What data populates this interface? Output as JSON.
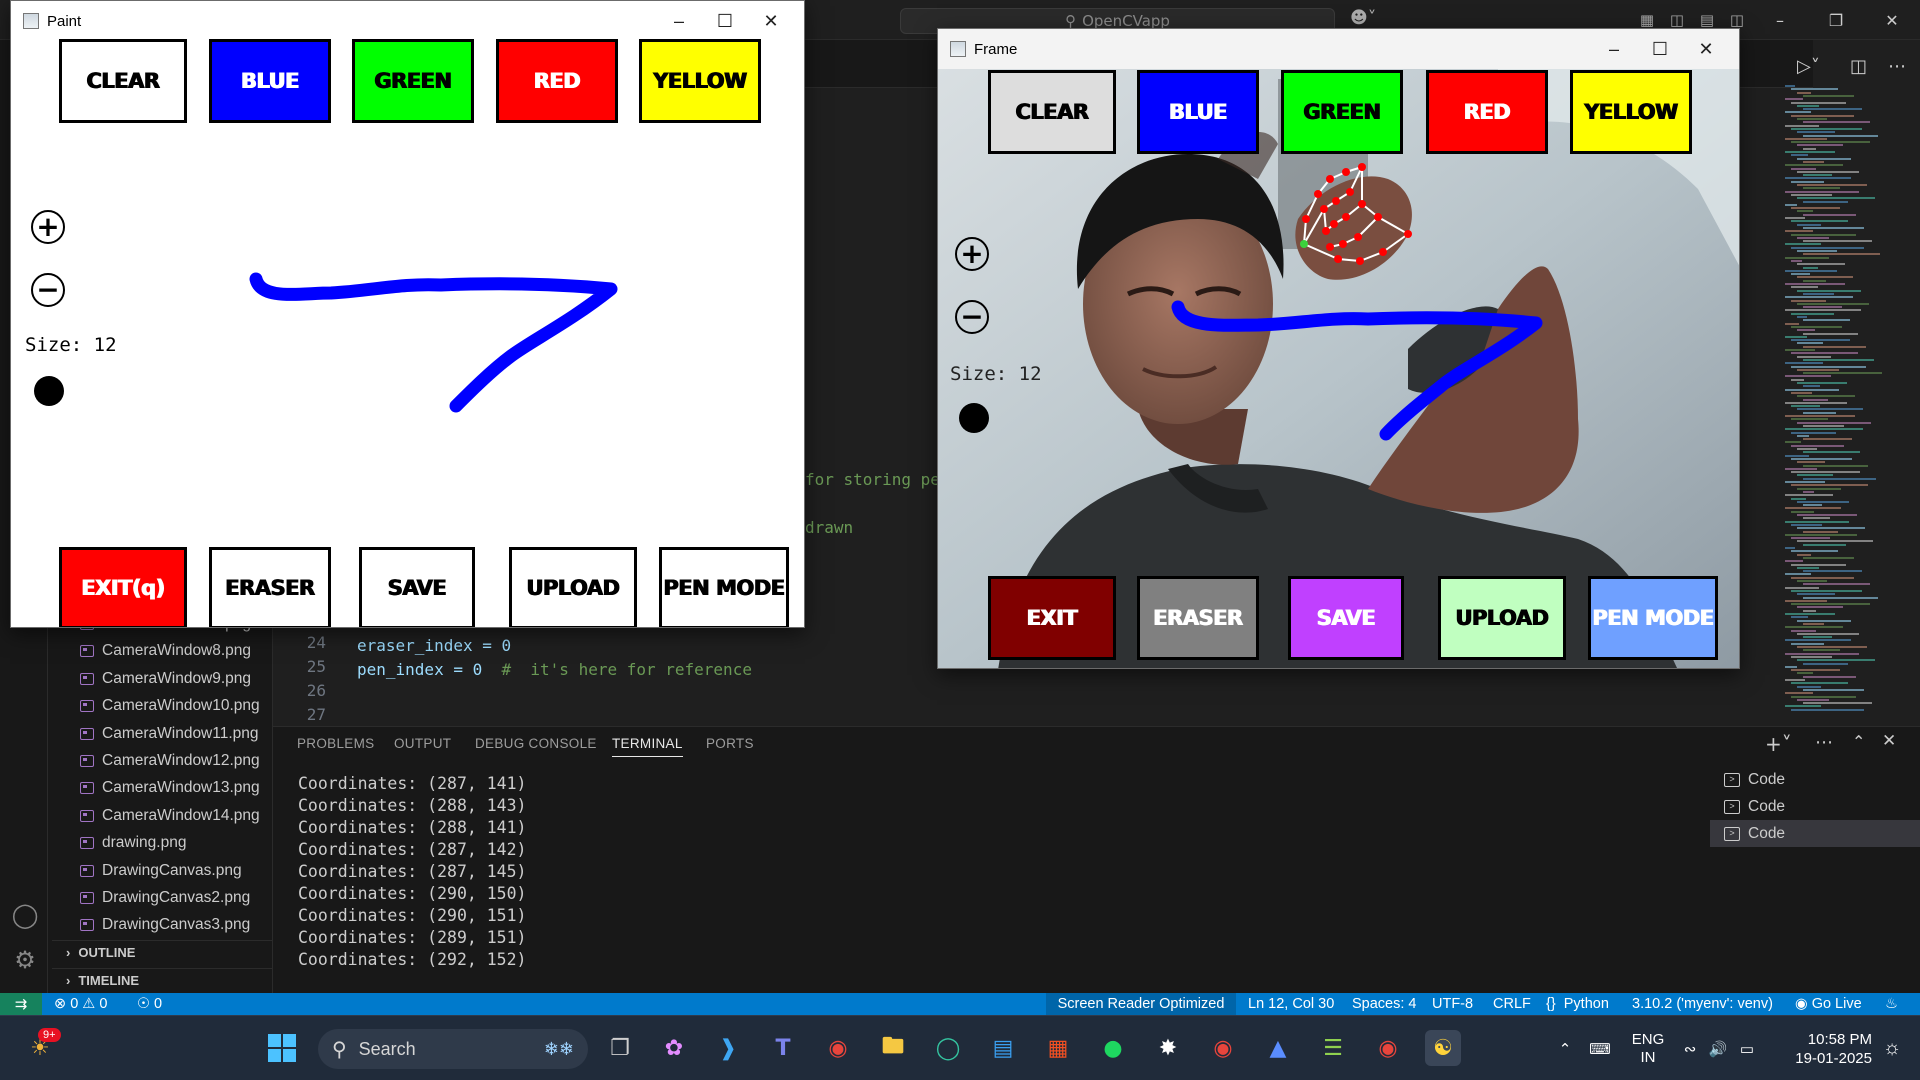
{
  "vscode": {
    "search_text": "OpenCVapp",
    "explorer_files": [
      "CameraWindow7.png",
      "CameraWindow8.png",
      "CameraWindow9.png",
      "CameraWindow10.png",
      "CameraWindow11.png",
      "CameraWindow12.png",
      "CameraWindow13.png",
      "CameraWindow14.png",
      "drawing.png",
      "DrawingCanvas.png",
      "DrawingCanvas2.png",
      "DrawingCanvas3.png"
    ],
    "outline_label": "OUTLINE",
    "timeline_label": "TIMELINE",
    "code": {
      "frag1": "for storing pe",
      "frag2": "drawn",
      "line24_num": "24",
      "line24": "eraser_index = 0",
      "line25_num": "25",
      "line25_code": "pen_index = 0",
      "line25_comment": "#  it's here for reference",
      "line26_num": "26",
      "line27_num": "27"
    },
    "panel_tabs": [
      "PROBLEMS",
      "OUTPUT",
      "DEBUG CONSOLE",
      "TERMINAL",
      "PORTS"
    ],
    "terminal_lines": [
      "Coordinates: (287, 141)",
      "Coordinates: (288, 143)",
      "Coordinates: (288, 141)",
      "Coordinates: (287, 142)",
      "Coordinates: (287, 145)",
      "Coordinates: (290, 150)",
      "Coordinates: (290, 151)",
      "Coordinates: (289, 151)",
      "Coordinates: (292, 152)"
    ],
    "terminal_instances": [
      "Code",
      "Code",
      "Code"
    ],
    "status": {
      "errors": "0",
      "warnings": "0",
      "ports": "0",
      "screen_reader": "Screen Reader Optimized",
      "position": "Ln 12, Col 30",
      "spaces": "Spaces: 4",
      "encoding": "UTF-8",
      "eol": "CRLF",
      "language": "Python",
      "interpreter": "3.10.2 ('myenv': venv)",
      "golive": "Go Live"
    }
  },
  "paint_window": {
    "title": "Paint",
    "top_buttons": [
      {
        "label": "CLEAR",
        "bg": "#ffffff",
        "fg": "#000000"
      },
      {
        "label": "BLUE",
        "bg": "#0000ff",
        "fg": "#ffffff"
      },
      {
        "label": "GREEN",
        "bg": "#00ff00",
        "fg": "#000000"
      },
      {
        "label": "RED",
        "bg": "#ff0000",
        "fg": "#ffffff"
      },
      {
        "label": "YELLOW",
        "bg": "#ffff00",
        "fg": "#000000"
      }
    ],
    "bottom_buttons": [
      {
        "label": "EXIT(q)",
        "bg": "#ff0000",
        "fg": "#ffffff"
      },
      {
        "label": "ERASER",
        "bg": "#ffffff",
        "fg": "#000000"
      },
      {
        "label": "SAVE",
        "bg": "#ffffff",
        "fg": "#000000"
      },
      {
        "label": "UPLOAD",
        "bg": "#ffffff",
        "fg": "#000000"
      },
      {
        "label": "PEN MODE",
        "bg": "#ffffff",
        "fg": "#000000"
      }
    ],
    "zoom_in": "+",
    "zoom_out": "−",
    "size_label": "Size:",
    "size_value": "12",
    "stroke_color": "#0000ff"
  },
  "frame_window": {
    "title": "Frame",
    "top_buttons": [
      {
        "label": "CLEAR",
        "bg": "#dddddd",
        "fg": "#000000"
      },
      {
        "label": "BLUE",
        "bg": "#0000ff",
        "fg": "#ffffff"
      },
      {
        "label": "GREEN",
        "bg": "#00ff00",
        "fg": "#000000"
      },
      {
        "label": "RED",
        "bg": "#ff0000",
        "fg": "#ffffff"
      },
      {
        "label": "YELLOW",
        "bg": "#ffff00",
        "fg": "#000000"
      }
    ],
    "bottom_buttons": [
      {
        "label": "EXIT",
        "bg": "#800000",
        "fg": "#ffffff"
      },
      {
        "label": "ERASER",
        "bg": "#808080",
        "fg": "#ffffff"
      },
      {
        "label": "SAVE",
        "bg": "#c040ff",
        "fg": "#ffffff"
      },
      {
        "label": "UPLOAD",
        "bg": "#c0ffc0",
        "fg": "#000000"
      },
      {
        "label": "PEN MODE",
        "bg": "#6fa0ff",
        "fg": "#ffffff"
      }
    ],
    "zoom_in": "+",
    "zoom_out": "−",
    "size_text": "Size: 12",
    "stroke_color": "#0000ff",
    "landmark_color": "#ff0000",
    "connection_color": "#ffffff"
  },
  "taskbar": {
    "search_label": "Search",
    "notification_badge": "9+",
    "lang_top": "ENG",
    "lang_bottom": "IN",
    "time": "10:58 PM",
    "date": "19-01-2025"
  }
}
